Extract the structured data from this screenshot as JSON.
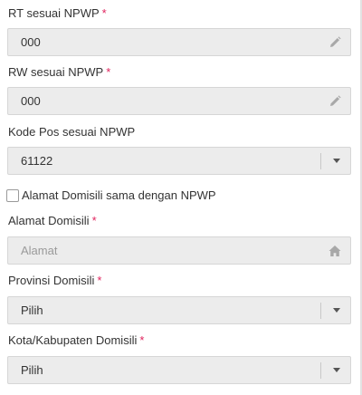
{
  "form": {
    "rt": {
      "label": "RT sesuai NPWP",
      "required_mark": "*",
      "value": "000",
      "icon": "pencil-icon"
    },
    "rw": {
      "label": "RW sesuai NPWP",
      "required_mark": "*",
      "value": "000",
      "icon": "pencil-icon"
    },
    "kode_pos": {
      "label": "Kode Pos sesuai NPWP",
      "value": "61122",
      "icon": "chevron-down-icon"
    },
    "same_address": {
      "label": "Alamat Domisili sama dengan NPWP",
      "checked": false
    },
    "alamat": {
      "label": "Alamat Domisili",
      "required_mark": "*",
      "placeholder": "Alamat",
      "icon": "home-icon"
    },
    "provinsi": {
      "label": "Provinsi Domisili",
      "required_mark": "*",
      "value": "Pilih",
      "icon": "chevron-down-icon"
    },
    "kota": {
      "label": "Kota/Kabupaten Domisili",
      "required_mark": "*",
      "value": "Pilih",
      "icon": "chevron-down-icon"
    }
  },
  "colors": {
    "required": "#e0245e",
    "field_bg": "#ececec",
    "field_border": "#d6d6d6",
    "text": "#333333",
    "placeholder": "#9a9a9a"
  }
}
